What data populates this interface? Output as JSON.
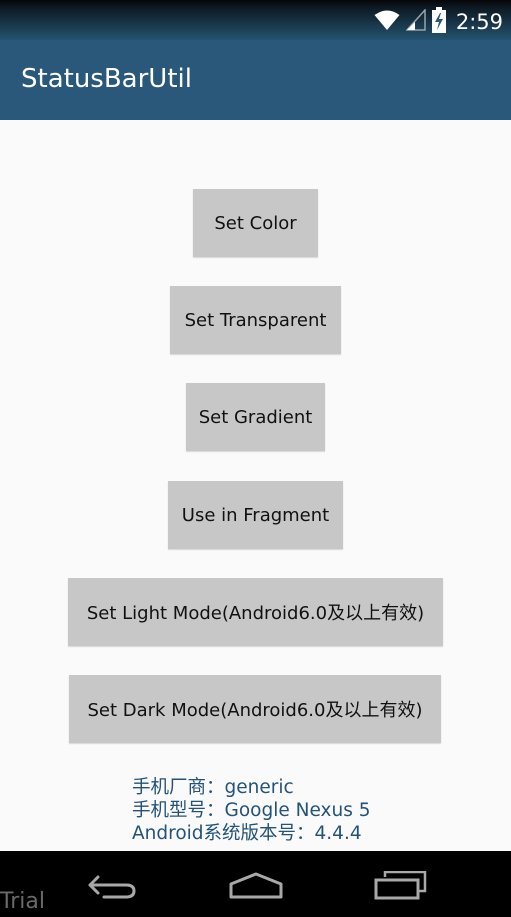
{
  "status_bar": {
    "time": "2:59",
    "icons": [
      "wifi-icon",
      "cell-signal-icon",
      "battery-charging-icon"
    ]
  },
  "app_bar": {
    "title": "StatusBarUtil"
  },
  "buttons": {
    "set_color": "Set Color",
    "set_transparent": "Set Transparent",
    "set_gradient": "Set Gradient",
    "use_in_fragment": "Use in Fragment",
    "set_light_mode": "Set Light Mode(Android6.0及以上有效)",
    "set_dark_mode": "Set Dark Mode(Android6.0及以上有效)"
  },
  "device_info": {
    "manufacturer": "手机厂商：generic",
    "model": "手机型号：Google Nexus 5",
    "android_version": "Android系统版本号：4.4.4"
  },
  "nav_bar": {
    "icons": [
      "back-icon",
      "home-icon",
      "recents-icon"
    ]
  },
  "watermark": "Trial",
  "colors": {
    "app_bar": "#29587a",
    "button": "#c7c7c7",
    "info_text": "#23537a",
    "background": "#fafafa"
  }
}
